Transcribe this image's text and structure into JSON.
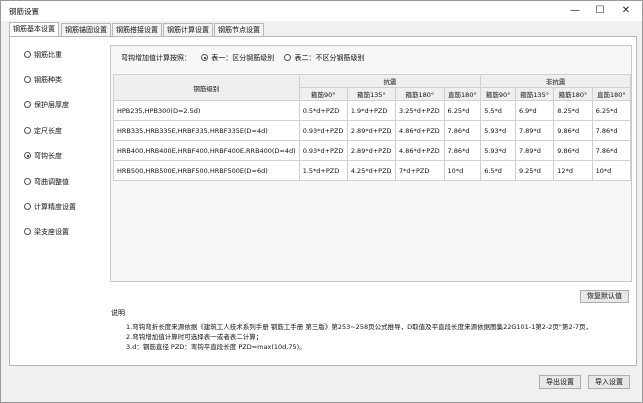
{
  "window": {
    "title": "钢筋设置",
    "minimize": "—",
    "maximize": "☐",
    "close": "✕"
  },
  "tabs": [
    "钢筋基本设置",
    "钢筋锚固设置",
    "钢筋搭接设置",
    "钢筋计算设置",
    "钢筋节点设置"
  ],
  "sidebar": {
    "items": [
      "钢筋比重",
      "钢筋种类",
      "保护层厚度",
      "定尺长度",
      "弯钩长度",
      "弯曲调整值",
      "计算精度设置",
      "梁支座设置"
    ],
    "selected": 4
  },
  "method": {
    "label": "弯钩增加值计算按照：",
    "option1": "表一：区分钢筋级别",
    "option2": "表二：不区分钢筋级别"
  },
  "table": {
    "grade_header": "钢筋级别",
    "group1": "抗震",
    "group2": "非抗震",
    "sub": [
      "箍筋90°",
      "箍筋135°",
      "箍筋180°",
      "直筋180°",
      "箍筋90°",
      "箍筋135°",
      "箍筋180°",
      "直筋180°"
    ],
    "rows": [
      {
        "grade": "HPB235,HPB300(D=2.5d)",
        "v": [
          "0.5*d+PZD",
          "1.9*d+PZD",
          "3.25*d+PZD",
          "6.25*d",
          "5.5*d",
          "6.9*d",
          "8.25*d",
          "6.25*d"
        ]
      },
      {
        "grade": "HRB335,HRB335E,HRBF335,HRBF335E(D=4d)",
        "v": [
          "0.93*d+PZD",
          "2.89*d+PZD",
          "4.86*d+PZD",
          "7.86*d",
          "5.93*d",
          "7.89*d",
          "9.86*d",
          "7.86*d"
        ]
      },
      {
        "grade": "HRB400,HRB400E,HRBF400,HRBF400E,RRB400(D=4d)",
        "v": [
          "0.93*d+PZD",
          "2.89*d+PZD",
          "4.86*d+PZD",
          "7.86*d",
          "5.93*d",
          "7.89*d",
          "9.86*d",
          "7.86*d"
        ]
      },
      {
        "grade": "HRB500,HRB500E,HRBF500,HRBF500E(D=6d)",
        "v": [
          "1.5*d+PZD",
          "4.25*d+PZD",
          "7*d+PZD",
          "10*d",
          "6.5*d",
          "9.25*d",
          "12*d",
          "10*d"
        ]
      }
    ]
  },
  "restore_button": "恢复默认值",
  "notes": {
    "label": "说明",
    "lines": [
      "1.弯钩弯折长度来源依据《建筑工人技术系列手册  钢筋工手册  第三版》第253~258页公式推导，D取值及平直段长度来源依据图集22G101-1第2-2页\"第2-7页，",
      "2.弯钩增加值计算时可选择表一或者表二计算；",
      "3.d：钢筋直径    PZD：弯钩平直段长度    PZD=max(10d,75)。"
    ]
  },
  "footer": {
    "export": "导出设置",
    "import": "导入设置"
  }
}
